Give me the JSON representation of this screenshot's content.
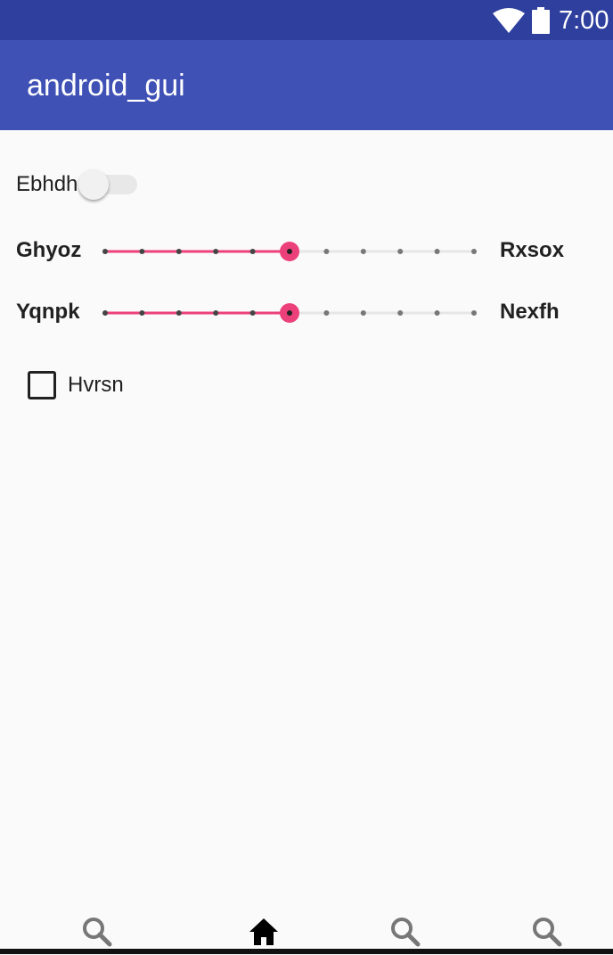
{
  "status_bar": {
    "time": "7:00",
    "icons": [
      "wifi-icon",
      "battery-icon"
    ]
  },
  "app_bar": {
    "title": "android_gui"
  },
  "content": {
    "switch": {
      "label": "Ebhdh",
      "checked": false
    },
    "slider1": {
      "left_label": "Ghyoz",
      "right_label": "Rxsox",
      "value": 5,
      "max": 10
    },
    "slider2": {
      "left_label": "Yqnpk",
      "right_label": "Nexfh",
      "value": 5,
      "max": 10
    },
    "checkbox": {
      "label": "Hvrsn",
      "checked": false
    }
  },
  "bottom_nav": {
    "items": [
      {
        "icon": "search-icon"
      },
      {
        "icon": "home-icon"
      },
      {
        "icon": "search-icon"
      },
      {
        "icon": "search-icon"
      }
    ]
  },
  "colors": {
    "status_bar": "#2f3f9e",
    "app_bar": "#3f51b5",
    "accent": "#ec407a",
    "background": "#fafafa"
  }
}
